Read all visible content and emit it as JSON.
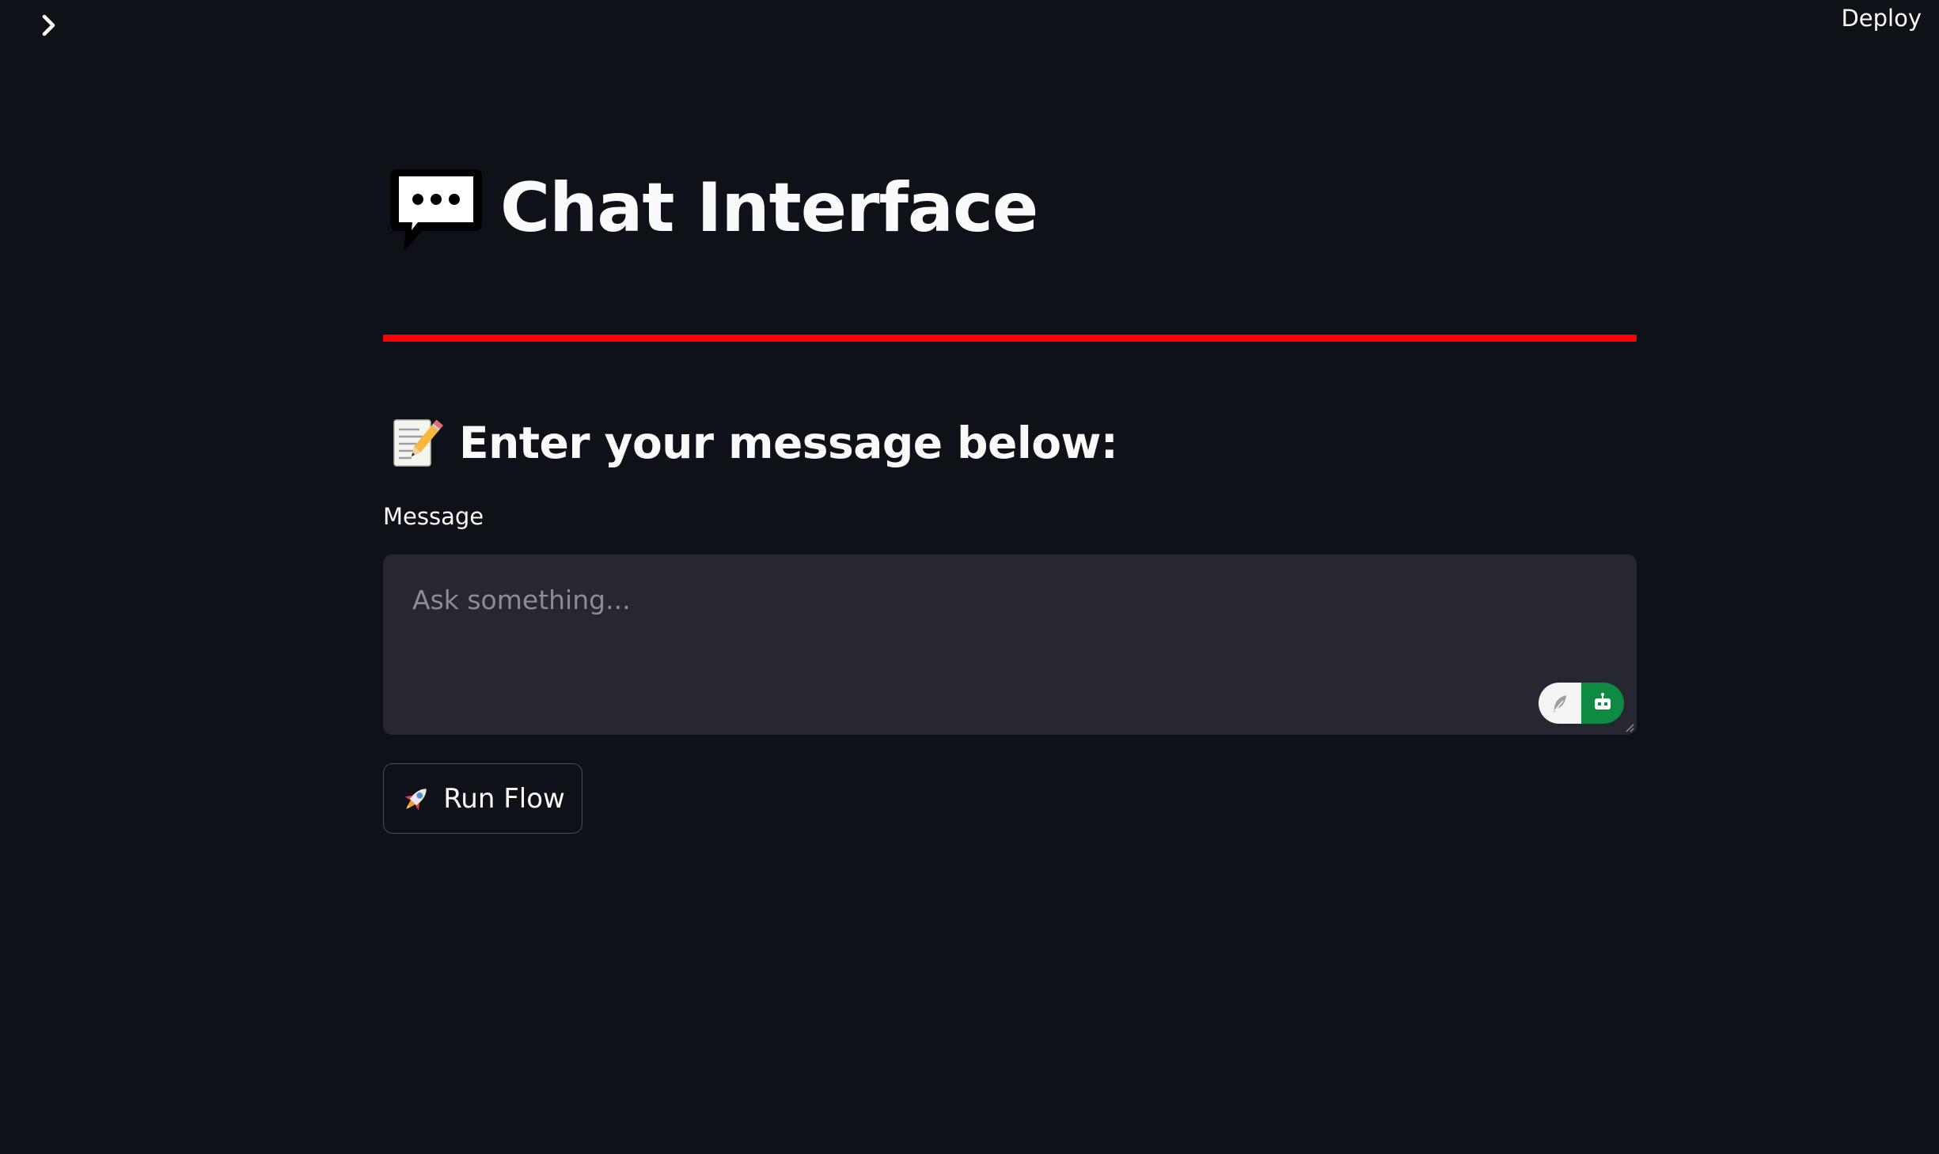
{
  "header": {
    "sidebar_toggle_icon": "chevron-right-icon",
    "deploy_label": "Deploy"
  },
  "main": {
    "title_icon": "speech-balloon-icon",
    "title": "Chat Interface",
    "divider_color": "#ff0000",
    "subheader_icon": "memo-icon",
    "subheader": "Enter your message below:",
    "message_field": {
      "label": "Message",
      "value": "",
      "placeholder": "Ask something...",
      "extension_icons": [
        "feather-icon",
        "robot-icon"
      ]
    },
    "run_button": {
      "icon": "rocket-icon",
      "label": "Run Flow"
    }
  },
  "colors": {
    "background": "#0e1117",
    "input_background": "#262730",
    "text": "#fafafa",
    "accent_divider": "#ff0000",
    "extension_green": "#0f8a43"
  }
}
